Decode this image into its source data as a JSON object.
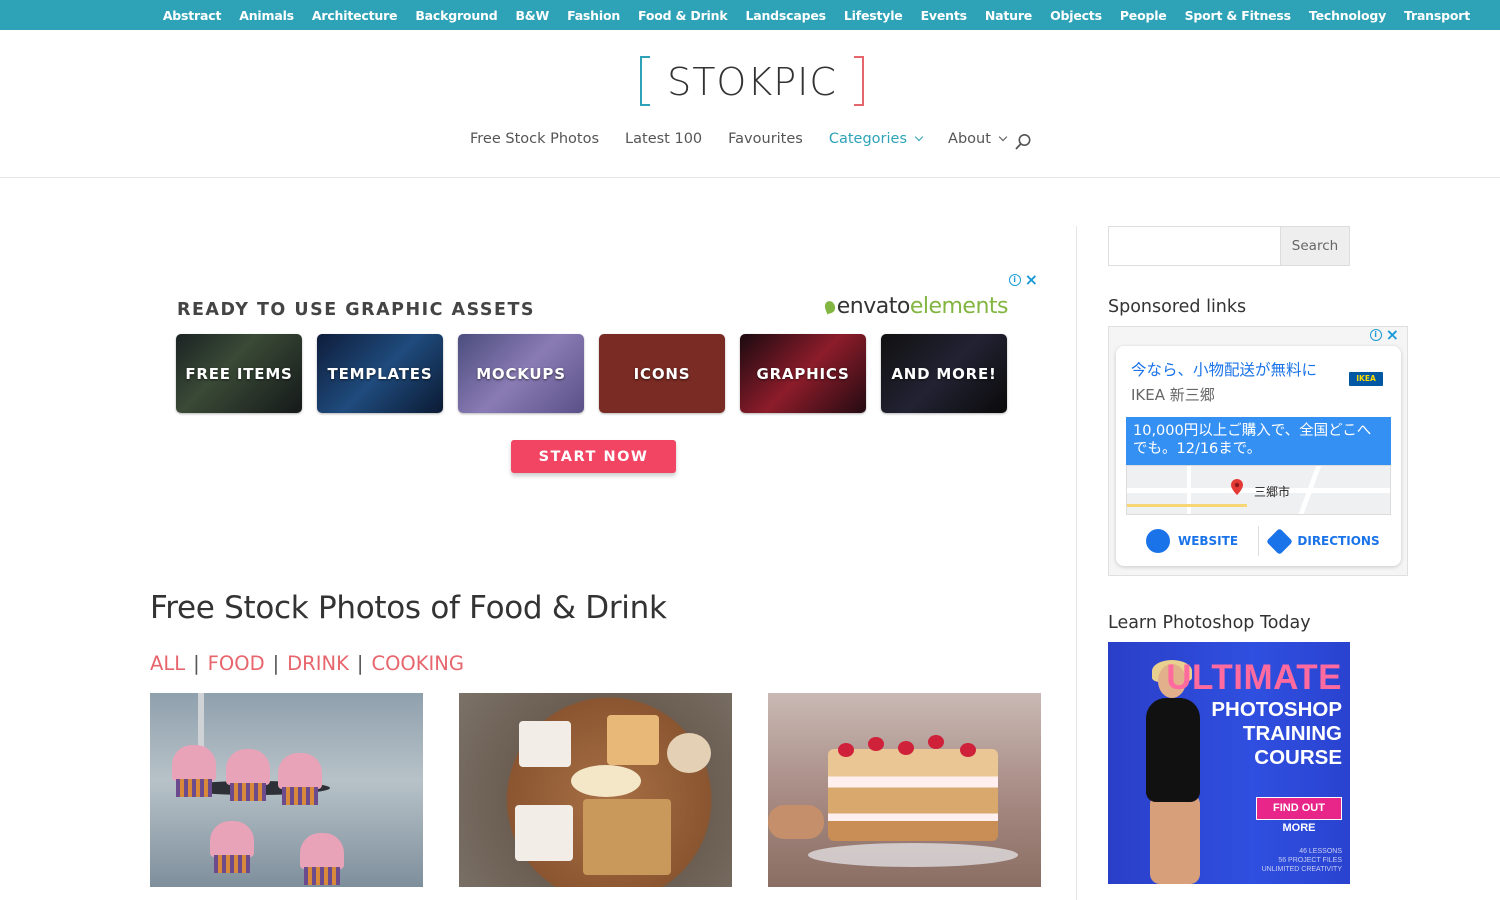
{
  "topbar": {
    "categories": [
      "Abstract",
      "Animals",
      "Architecture",
      "Background",
      "B&W",
      "Fashion",
      "Food & Drink",
      "Landscapes",
      "Lifestyle",
      "Events",
      "Nature",
      "Objects",
      "People",
      "Sport & Fitness",
      "Technology",
      "Transport"
    ]
  },
  "header": {
    "logo_text": "STOKPIC",
    "nav": [
      {
        "label": "Free Stock Photos",
        "dropdown": false
      },
      {
        "label": "Latest 100",
        "dropdown": false
      },
      {
        "label": "Favourites",
        "dropdown": false
      },
      {
        "label": "Categories",
        "dropdown": true,
        "active": true
      },
      {
        "label": "About",
        "dropdown": true
      }
    ],
    "search_icon": "search-icon"
  },
  "colors": {
    "teal": "#2ea3b7",
    "coral": "#e7666d",
    "envato_green": "#82b541",
    "start_red": "#f24563"
  },
  "ad_envato": {
    "headline": "READY TO USE GRAPHIC ASSETS",
    "brand_a": "envato",
    "brand_b": "elements",
    "tiles": [
      "FREE ITEMS",
      "TEMPLATES",
      "MOCKUPS",
      "ICONS",
      "GRAPHICS",
      "AND MORE!"
    ],
    "cta": "START NOW"
  },
  "main": {
    "title": "Free Stock Photos of Food & Drink",
    "filters": [
      "ALL",
      "FOOD",
      "DRINK",
      "COOKING"
    ]
  },
  "sidebar": {
    "search_placeholder": "",
    "search_button": "Search",
    "sponsored_heading": "Sponsored links",
    "learn_heading": "Learn Photoshop Today"
  },
  "ad_ikea": {
    "headline": "今なら、小物配送が無料に",
    "advertiser": "IKEA 新三郷",
    "logo": "IKEA",
    "offer": "10,000円以上ご購入で、全国どこへでも。12/16まで。",
    "map_label": "三郷市",
    "website_label": "WEBSITE",
    "directions_label": "DIRECTIONS"
  },
  "ad_ps": {
    "line1": "ULTIMATE",
    "line2": "PHOTOSHOP",
    "line3": "TRAINING",
    "line4": "COURSE",
    "cta": "FIND OUT MORE",
    "fine1": "46 LESSONS",
    "fine2": "56 PROJECT FILES",
    "fine3": "UNLIMITED CREATIVITY"
  }
}
